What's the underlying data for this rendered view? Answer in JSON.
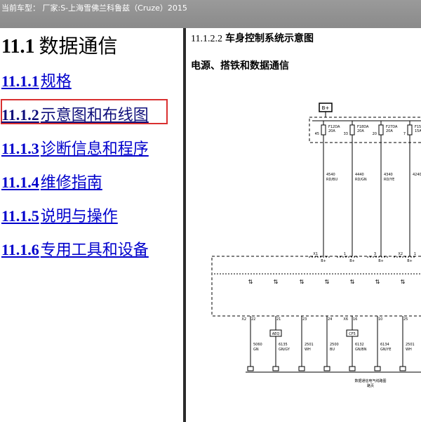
{
  "window": {
    "title": "当前车型： 厂家:S-上海雪佛兰科鲁兹（Cruze）2015"
  },
  "toc": {
    "heading_num": "11.1",
    "heading_text": "数据通信",
    "items": [
      {
        "num": "11.1.1",
        "text": "规格"
      },
      {
        "num": "11.1.2",
        "text": "示意图和布线图"
      },
      {
        "num": "11.1.3",
        "text": "诊断信息和程序"
      },
      {
        "num": "11.1.4",
        "text": "维修指南"
      },
      {
        "num": "11.1.5",
        "text": "说明与操作"
      },
      {
        "num": "11.1.6",
        "text": "专用工具和设备"
      }
    ],
    "active_index": 1
  },
  "content": {
    "section_num": "11.1.2.2",
    "section_title": "车身控制系统示意图",
    "subtitle": "电源、搭铁和数据通信"
  },
  "diagram": {
    "top_label": "B+",
    "fuses": [
      {
        "name": "F12DA",
        "rating": "20A",
        "pin": "45"
      },
      {
        "name": "F18DA",
        "rating": "20A",
        "pin": "33"
      },
      {
        "name": "F27DA",
        "rating": "20A",
        "pin": "20"
      },
      {
        "name": "F15",
        "rating": "15A",
        "pin": "7"
      }
    ],
    "wires_top": [
      {
        "circuit": "4540",
        "color": "RD/BU"
      },
      {
        "circuit": "4440",
        "color": "RD/GN"
      },
      {
        "circuit": "4340",
        "color": "RD/YE"
      },
      {
        "circuit": "4240",
        "color": ""
      }
    ],
    "connectors_mid": [
      "X1",
      "1",
      "3",
      "B+",
      "X2",
      "1"
    ],
    "bplus_labels": [
      "B+",
      "B+",
      "B+",
      "B+"
    ],
    "bottom_pins": [
      {
        "conn": "X2",
        "pin": "22",
        "circuit": "5060",
        "color": "GN",
        "tag": ""
      },
      {
        "conn": "",
        "pin": "21",
        "circuit": "6135",
        "color": "GN/GY",
        "tag": "AEQ"
      },
      {
        "conn": "",
        "pin": "23",
        "circuit": "2501",
        "color": "WH",
        "tag": ""
      },
      {
        "conn": "",
        "pin": "24",
        "circuit": "2500",
        "color": "BU",
        "tag": ""
      },
      {
        "conn": "X6",
        "pin": "16",
        "circuit": "6132",
        "color": "GN/BN",
        "tag": "CF5"
      },
      {
        "conn": "",
        "pin": "10",
        "circuit": "6134",
        "color": "GN/YE",
        "tag": ""
      },
      {
        "conn": "",
        "pin": "25",
        "circuit": "2501",
        "color": "WH",
        "tag": ""
      }
    ],
    "bottom_caption": "数据通信电气线路图",
    "bottom_caption2": "路页"
  },
  "colors": {
    "link": "#0000cc",
    "active_box": "#d93030",
    "titlebar": "#9a9a9a"
  }
}
